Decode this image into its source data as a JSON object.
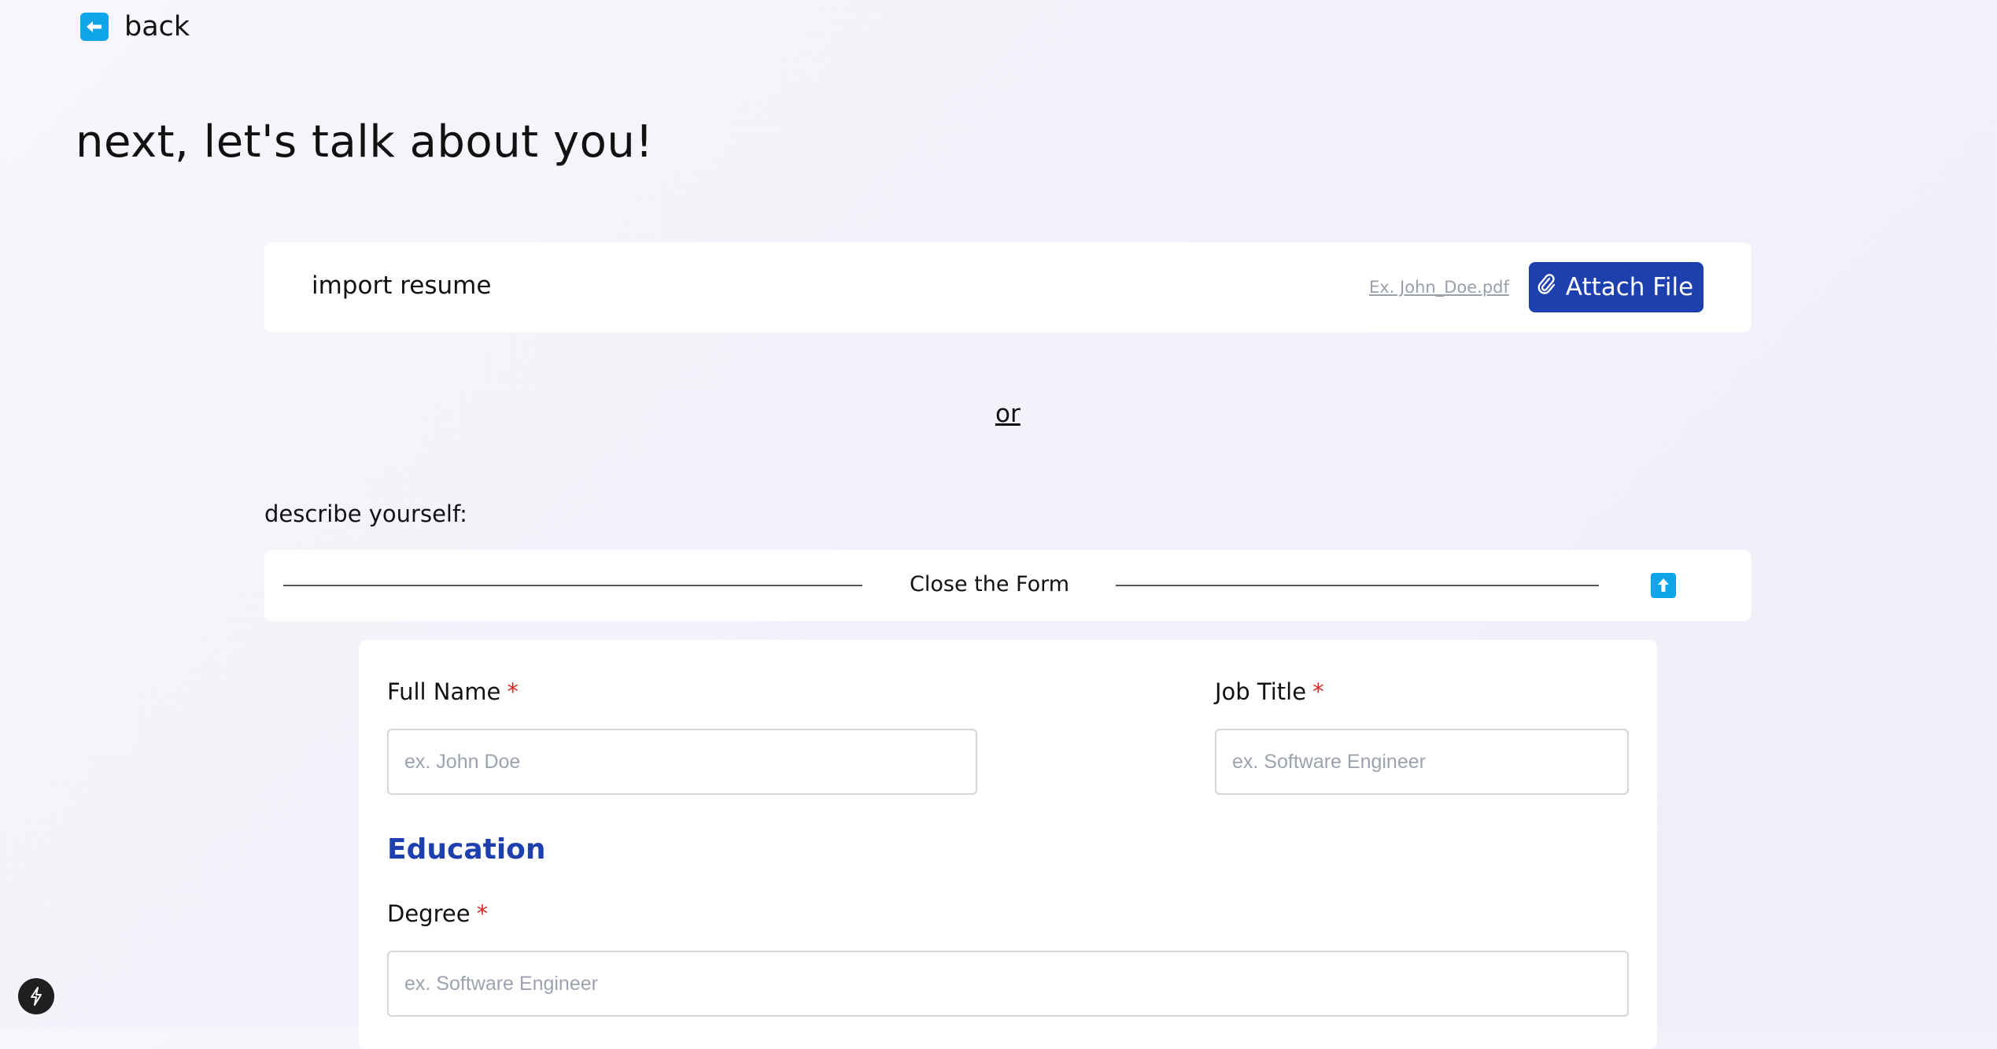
{
  "nav": {
    "back_label": "back"
  },
  "page": {
    "title": "next, let's talk about you!"
  },
  "import": {
    "label": "import resume",
    "file_placeholder": "Ex. John_Doe.pdf",
    "attach_label": "Attach File"
  },
  "separator": {
    "or_label": "or"
  },
  "describe": {
    "label": "describe yourself:",
    "close_form_label": "Close the Form"
  },
  "form": {
    "full_name": {
      "label": "Full Name",
      "required_mark": "*",
      "placeholder": "ex. John Doe"
    },
    "job_title": {
      "label": "Job Title",
      "required_mark": "*",
      "placeholder": "ex. Software Engineer"
    },
    "education_heading": "Education",
    "degree": {
      "label": "Degree",
      "required_mark": "*",
      "placeholder": "ex. Software Engineer"
    }
  },
  "colors": {
    "accent": "#1e40af",
    "icon_blue": "#0ea5e9",
    "required": "#dc2626"
  },
  "icons": {
    "back": "arrow-left-icon",
    "attach": "paperclip-icon",
    "collapse": "arrow-up-icon",
    "badge": "lightning-bolt-icon"
  }
}
